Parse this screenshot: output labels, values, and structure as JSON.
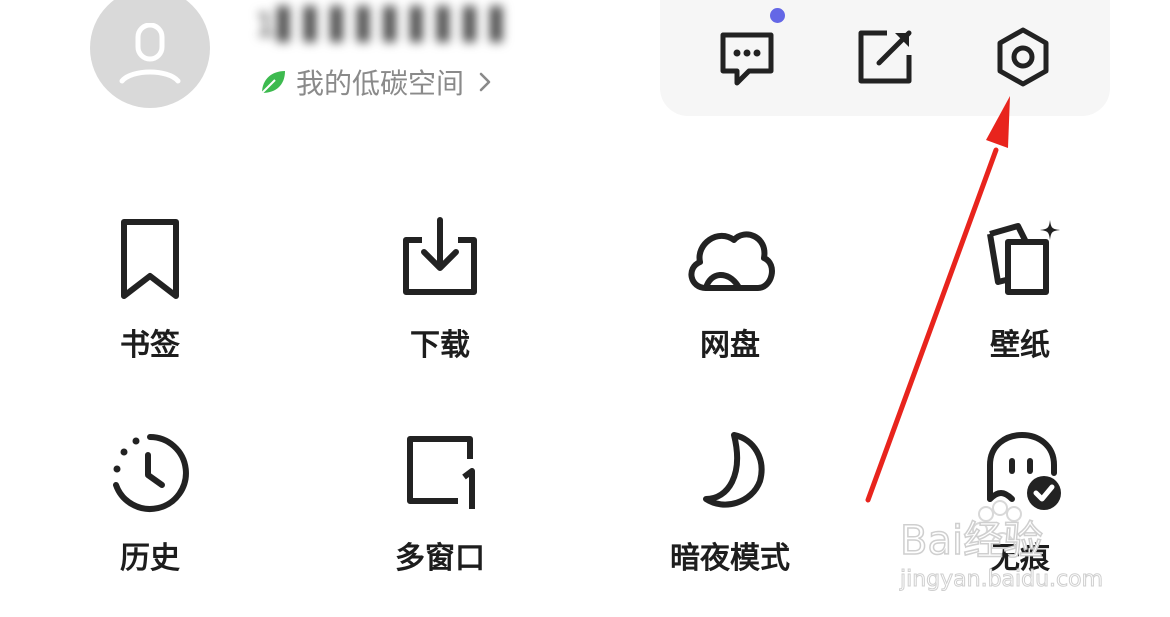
{
  "profile": {
    "username": "1▌▌▌▌▌▌▌▌▌▌▌▌5",
    "link_text": "我的低碳空间"
  },
  "toolbar": {
    "messages_icon": "chat-bubble-icon",
    "edit_icon": "edit-box-icon",
    "settings_icon": "settings-hexagon-icon",
    "badge_color": "#6467e6"
  },
  "grid": {
    "items": [
      {
        "label": "书签",
        "icon": "bookmark-icon"
      },
      {
        "label": "下载",
        "icon": "download-icon"
      },
      {
        "label": "网盘",
        "icon": "cloud-icon"
      },
      {
        "label": "壁纸",
        "icon": "wallpaper-icon"
      },
      {
        "label": "历史",
        "icon": "history-clock-icon"
      },
      {
        "label": "多窗口",
        "icon": "multi-window-icon"
      },
      {
        "label": "暗夜模式",
        "icon": "moon-icon"
      },
      {
        "label": "无痕",
        "icon": "incognito-ghost-icon"
      }
    ]
  },
  "watermark": {
    "brand_text": "Bai经验",
    "url_text": "jingyan.baidu.com"
  },
  "colors": {
    "leaf": "#3dba4f",
    "arrow": "#e8241d",
    "icon_stroke": "#222222"
  }
}
